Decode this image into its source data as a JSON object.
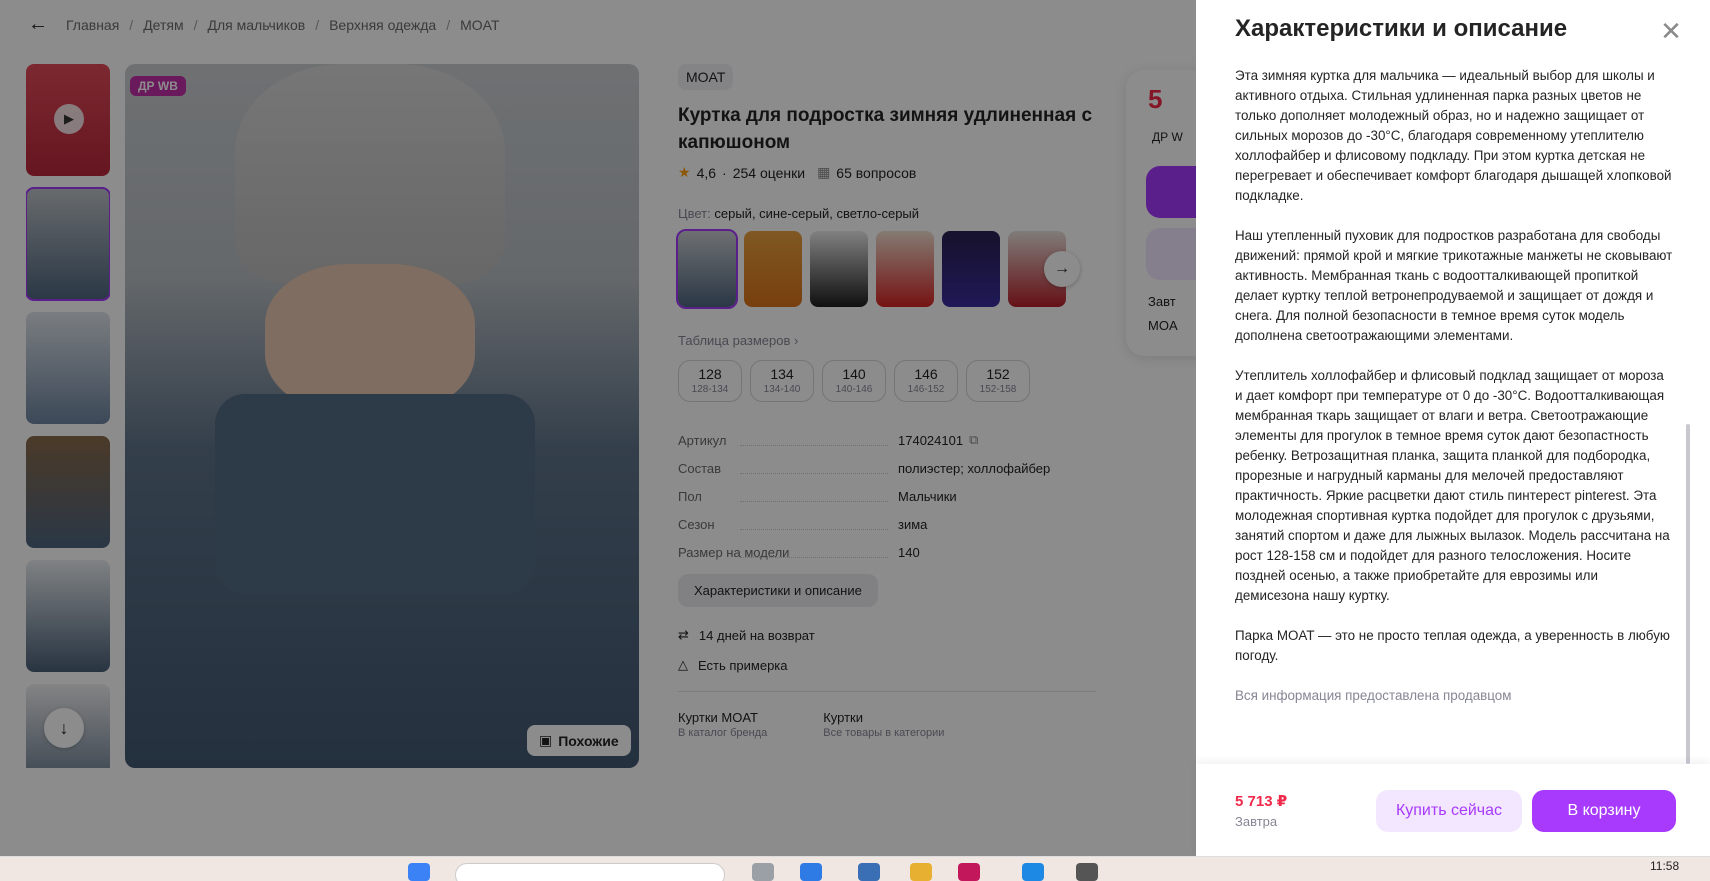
{
  "breadcrumbs": [
    "Главная",
    "Детям",
    "Для мальчиков",
    "Верхняя одежда",
    "MOAT"
  ],
  "badge": "ДР WB",
  "similar_button": "Похожие",
  "product": {
    "brand": "MOAT",
    "title": "Куртка для подростка зимняя удлиненная с капюшоном",
    "rating": "4,6",
    "reviews": "254 оценки",
    "questions": "65 вопросов",
    "color_label": "Цвет:",
    "color_value": "серый, сине-серый, светло-серый",
    "size_table_link": "Таблица размеров",
    "sizes": [
      {
        "n": "128",
        "r": "128-134"
      },
      {
        "n": "134",
        "r": "134-140"
      },
      {
        "n": "140",
        "r": "140-146"
      },
      {
        "n": "146",
        "r": "146-152"
      },
      {
        "n": "152",
        "r": "152-158"
      }
    ],
    "props": [
      {
        "k": "Артикул",
        "v": "174024101"
      },
      {
        "k": "Состав",
        "v": "полиэстер; холлофайбер"
      },
      {
        "k": "Пол",
        "v": "Мальчики"
      },
      {
        "k": "Сезон",
        "v": "зима"
      },
      {
        "k": "Размер на модели",
        "v": "140"
      }
    ],
    "specs_button": "Характеристики и описание",
    "perks": [
      "14 дней на возврат",
      "Есть примерка"
    ],
    "links": [
      {
        "t": "Куртки MOAT",
        "s": "В каталог бренда"
      },
      {
        "t": "Куртки",
        "s": "Все товары в категории"
      }
    ]
  },
  "buy_card": {
    "price_fragment": "5",
    "wb_fragment": "ДР W",
    "delivery_fragment_1": "Завт",
    "delivery_fragment_2": "MOA"
  },
  "panel": {
    "title": "Характеристики и описание",
    "paragraphs": [
      "Эта зимняя куртка для мальчика — идеальный выбор для школы и активного отдыха. Стильная удлиненная парка разных цветов не только дополняет молодежный образ, но и надежно защищает от сильных морозов до -30°С, благодаря современному утеплителю холлофайбер и флисовому подкладу. При этом куртка детская не перегревает и обеспечивает комфорт благодаря дышащей хлопковой подкладке.",
      "Наш утепленный пуховик для подростков разработана для свободы движений: прямой крой и мягкие трикотажные манжеты не сковывают активность. Мембранная ткань с водоотталкивающей пропиткой делает куртку теплой ветронепродуваемой и защищает от дождя и снега. Для полной безопасности в темное время суток модель дополнена светоотражающими элементами.",
      "Утеплитель холлофайбер и флисовый подклад защищает от мороза и дает комфорт при температуре от 0 до -30°С. Водоотталкивающая мембранная ткарь защищает от влаги и ветра. Светоотражающие элементы для прогулок в темное время суток дают безопастность ребенку. Ветрозащитная планка, защита планкой для подбородка, прорезные и нагрудный карманы для мелочей предоставляют практичность. Яркие расцветки дают стиль пинтерест pinterest. Эта молодежная спортивная куртка подойдет для прогулок с друзьями, занятий спортом и даже для лыжных вылазок. Модель рассчитана на рост 128-158 см и подойдет для разного телосложения. Носите поздней осенью, а также приобретайте для еврозимы или демисезона нашу куртку.",
      "Парка MOAT — это не просто теплая одежда, а уверенность в любую погоду."
    ],
    "note": "Вся информация предоставлена продавцом",
    "price": "5 713 ₽",
    "delivery": "Завтра",
    "buy_now": "Купить сейчас",
    "to_cart": "В корзину"
  },
  "taskbar": {
    "time": "11:58"
  },
  "colors": {
    "accent": "#a73afd",
    "price": "#f0294a"
  }
}
